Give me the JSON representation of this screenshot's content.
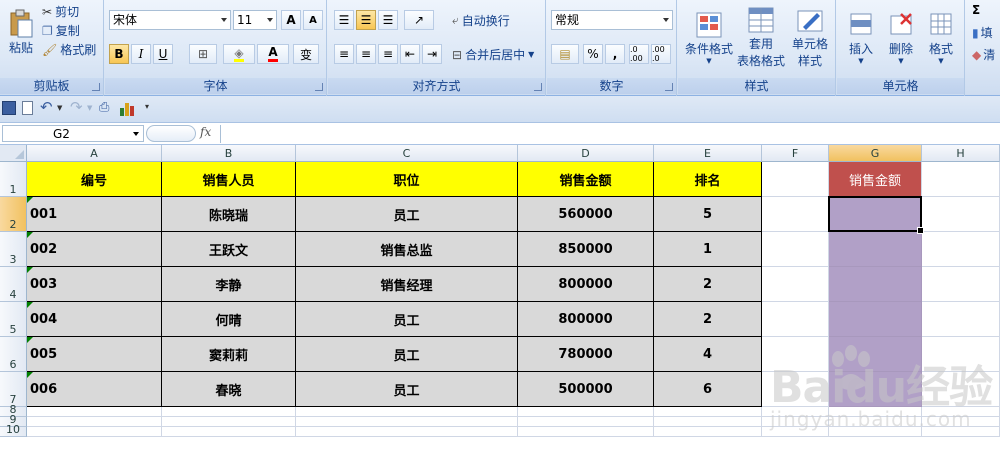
{
  "ribbon": {
    "clipboard": {
      "label": "剪贴板",
      "paste": "粘贴",
      "cut": "剪切",
      "copy": "复制",
      "format_painter": "格式刷"
    },
    "font": {
      "label": "字体",
      "font_name": "宋体",
      "font_size": "11",
      "grow": "A",
      "shrink": "A",
      "bold": "B",
      "italic": "I",
      "underline": "U",
      "phonetic": "变"
    },
    "alignment": {
      "label": "对齐方式",
      "wrap_text": "自动换行",
      "merge_center": "合并后居中"
    },
    "number": {
      "label": "数字",
      "format": "常规",
      "percent": "%",
      "comma": ",",
      "inc_decimal": ".0 .00",
      "dec_decimal": ".00 .0"
    },
    "styles": {
      "label": "样式",
      "conditional": "条件格式",
      "table_format_1": "套用",
      "table_format_2": "表格格式",
      "cell_styles_1": "单元格",
      "cell_styles_2": "样式"
    },
    "cells": {
      "label": "单元格",
      "insert": "插入",
      "delete": "删除",
      "format": "格式"
    },
    "editing": {
      "sum": "Σ",
      "fill": "填",
      "clear": "清"
    },
    "colors": {
      "accent": "#15428b",
      "ribbon_bg": "#dde8f6"
    }
  },
  "formula_bar": {
    "name_box": "G2",
    "fx": "fx",
    "content": ""
  },
  "grid": {
    "columns": [
      "A",
      "B",
      "C",
      "D",
      "E",
      "F",
      "G",
      "H"
    ],
    "rows": [
      "1",
      "2",
      "3",
      "4",
      "5",
      "6",
      "7",
      "8",
      "9",
      "10"
    ],
    "headers": [
      "编号",
      "销售人员",
      "职位",
      "销售金额",
      "排名"
    ],
    "data": [
      [
        "001",
        "陈晓瑞",
        "员工",
        "560000",
        "5"
      ],
      [
        "002",
        "王跃文",
        "销售总监",
        "850000",
        "1"
      ],
      [
        "003",
        "李静",
        "销售经理",
        "800000",
        "2"
      ],
      [
        "004",
        "何晴",
        "员工",
        "800000",
        "2"
      ],
      [
        "005",
        "窦莉莉",
        "员工",
        "780000",
        "4"
      ],
      [
        "006",
        "春晓",
        "员工",
        "500000",
        "6"
      ]
    ],
    "g_header": "销售金额",
    "selected_cell": "G2",
    "colors": {
      "header_fill": "#ffff00",
      "data_fill": "#d9d9d9",
      "g_header_fill": "#c0504d",
      "g_data_fill": "#b1a0c7"
    }
  },
  "watermark": {
    "brand": "Baidu经验",
    "site": "jingyan.baidu.com"
  }
}
